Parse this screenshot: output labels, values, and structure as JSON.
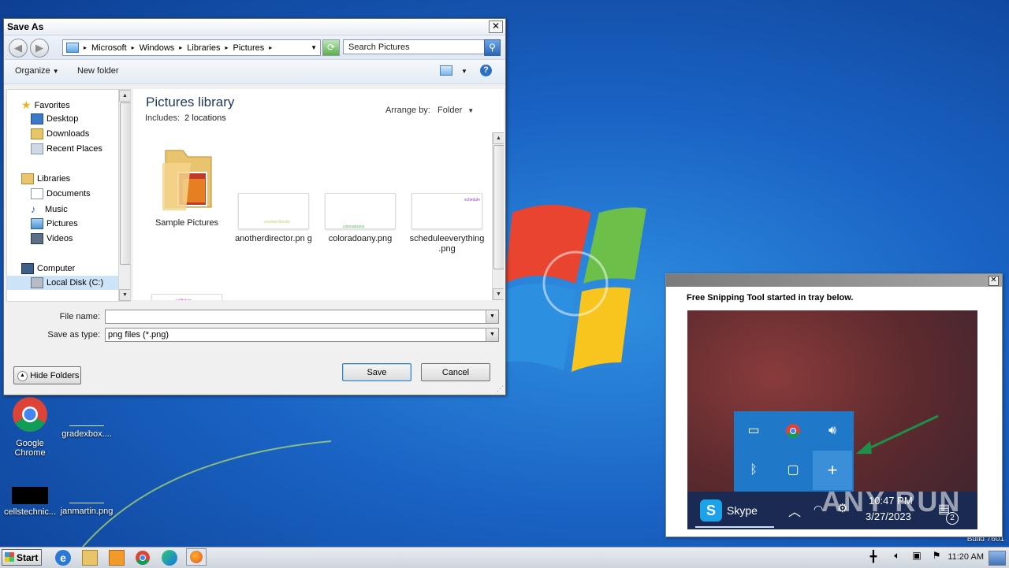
{
  "window": {
    "title": "Save As",
    "close": "✕",
    "breadcrumb": [
      "Microsoft",
      "Windows",
      "Libraries",
      "Pictures"
    ],
    "search_placeholder": "Search Pictures",
    "toolbar": {
      "organize": "Organize",
      "new_folder": "New folder"
    },
    "nav": {
      "favorites": "Favorites",
      "favorites_items": [
        "Desktop",
        "Downloads",
        "Recent Places"
      ],
      "libraries": "Libraries",
      "libraries_items": [
        "Documents",
        "Music",
        "Pictures",
        "Videos"
      ],
      "computer": "Computer",
      "computer_items": [
        "Local Disk (C:)"
      ]
    },
    "library_title": "Pictures library",
    "library_includes": "Includes:",
    "library_locations": "2 locations",
    "arrange_by_label": "Arrange by:",
    "arrange_by_value": "Folder",
    "files": [
      {
        "name": "Sample Pictures",
        "kind": "folder"
      },
      {
        "name": "anotherdirector.pn g",
        "kind": "image",
        "mini": "anotherdirector"
      },
      {
        "name": "coloradoany.png",
        "kind": "image",
        "mini": "coloradoany"
      },
      {
        "name": "scheduleeverything .png",
        "kind": "image",
        "mini": "schedule"
      },
      {
        "name": "",
        "kind": "image",
        "mini": "selftaken"
      }
    ],
    "file_name_label": "File name:",
    "file_name_value": "",
    "save_type_label": "Save as type:",
    "save_type_value": "png files (*.png)",
    "save_button": "Save",
    "cancel_button": "Cancel",
    "hide_folders": "Hide Folders"
  },
  "desktop_icons": [
    {
      "label": "Google Chrome"
    },
    {
      "label": "gradexbox...."
    },
    {
      "label": "cellstechnic..."
    },
    {
      "label": "janmartin.png"
    }
  ],
  "build_text": "Build 7601",
  "snip": {
    "message": "Free Snipping Tool started in tray below.",
    "close": "✕",
    "app_name": "Skype",
    "time": "10:47 PM",
    "date": "3/27/2023",
    "badge": "2",
    "watermark": "ANY RUN"
  },
  "taskbar": {
    "start": "Start",
    "time": "11:20 AM"
  },
  "colors": {
    "desktop": "#1a63c4",
    "tray_blue": "#1f78c8",
    "arrow_green": "#1e8f4a"
  }
}
